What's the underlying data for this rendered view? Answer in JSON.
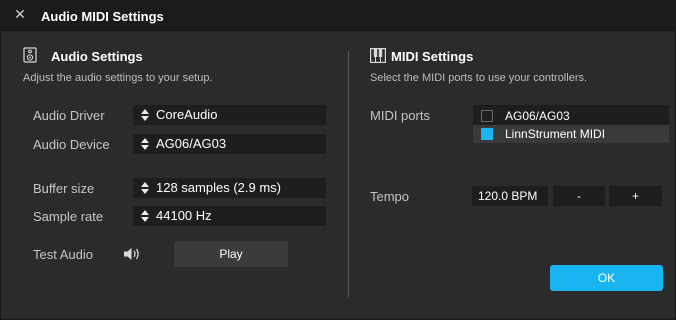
{
  "window": {
    "title": "Audio MIDI Settings",
    "close_glyph": "✕"
  },
  "audio": {
    "heading": "Audio Settings",
    "icon": "speaker-box-icon",
    "description": "Adjust the audio settings to your setup.",
    "driver_label": "Audio Driver",
    "driver_value": "CoreAudio",
    "device_label": "Audio Device",
    "device_value": "AG06/AG03",
    "buffer_label": "Buffer size",
    "buffer_value": "128 samples (2.9 ms)",
    "rate_label": "Sample rate",
    "rate_value": "44100 Hz",
    "test_label": "Test Audio",
    "play_label": "Play"
  },
  "midi": {
    "heading": "MIDI Settings",
    "icon": "piano-keys-icon",
    "description": "Select the MIDI ports to use your controllers.",
    "ports_label": "MIDI ports",
    "ports": [
      {
        "name": "AG06/AG03",
        "checked": false,
        "selected": false
      },
      {
        "name": "LinnStrument MIDI",
        "checked": true,
        "selected": true
      }
    ],
    "tempo_label": "Tempo",
    "tempo_value": "120.0 BPM",
    "decrease_label": "-",
    "increase_label": "+"
  },
  "footer": {
    "ok_label": "OK"
  },
  "colors": {
    "accent": "#19b5f0",
    "window_bg": "#2b2b2d",
    "field_bg": "#1e1e20"
  }
}
